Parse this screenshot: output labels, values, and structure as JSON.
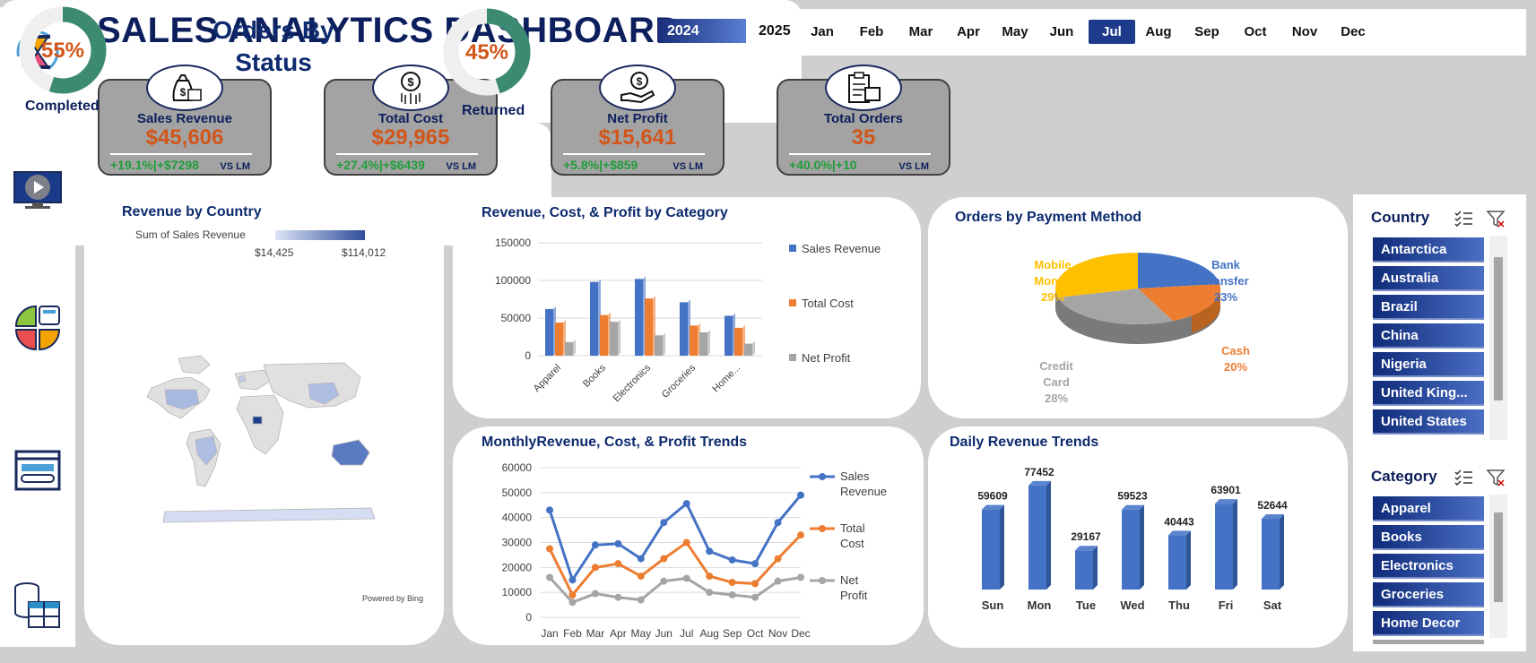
{
  "header": {
    "title": "SALES ANALYTICS DASHBOARD",
    "years": [
      "2024",
      "2025"
    ],
    "selected_year": "2024",
    "months": [
      "Jan",
      "Feb",
      "Mar",
      "Apr",
      "May",
      "Jun",
      "Jul",
      "Aug",
      "Sep",
      "Oct",
      "Nov",
      "Dec"
    ],
    "selected_month": "Jul"
  },
  "kpis": [
    {
      "title": "Sales Revenue",
      "value": "$45,606",
      "change": "+19.1%|+$7298",
      "vs": "VS LM",
      "icon": "money-bag-icon"
    },
    {
      "title": "Total Cost",
      "value": "$29,965",
      "change": "+27.4%|+$6439",
      "vs": "VS LM",
      "icon": "dollar-arrows-icon"
    },
    {
      "title": "Net Profit",
      "value": "$15,641",
      "change": "+5.8%|+$859",
      "vs": "VS LM",
      "icon": "hand-dollar-icon"
    },
    {
      "title": "Total Orders",
      "value": "35",
      "change": "+40.0%|+10",
      "vs": "VS LM",
      "icon": "clipboard-box-icon"
    }
  ],
  "orders_status": {
    "title_line1": "Orders By",
    "title_line2": "Status",
    "completed_label": "Completed",
    "completed_pct": "55%",
    "completed_value": 55,
    "returned_label": "Returned",
    "returned_pct": "45%",
    "returned_value": 45
  },
  "map": {
    "title": "Revenue by Country",
    "legend_title": "Sum of Sales Revenue",
    "legend_min": "$14,425",
    "legend_max": "$114,012",
    "attribution": "Powered by Bing"
  },
  "category_chart": {
    "title": "Revenue, Cost, & Profit by Category",
    "y_ticks": [
      "150000",
      "100000",
      "50000",
      "0"
    ],
    "categories": [
      "Apparel",
      "Books",
      "Electronics",
      "Groceries",
      "Home..."
    ],
    "legend": [
      "Sales Revenue",
      "Total Cost",
      "Net Profit"
    ]
  },
  "payment_chart": {
    "title": "Orders by Payment Method",
    "slices": [
      {
        "name": "Bank Transfer",
        "line1": "Bank",
        "line2": "Transfer",
        "pct": "23%",
        "value": 23,
        "color": "#4472c4"
      },
      {
        "name": "Cash",
        "line1": "Cash",
        "line2": "",
        "pct": "20%",
        "value": 20,
        "color": "#ed7d31"
      },
      {
        "name": "Credit Card",
        "line1": "Credit",
        "line2": "Card",
        "pct": "28%",
        "value": 28,
        "color": "#a5a5a5"
      },
      {
        "name": "Mobile Money",
        "line1": "Mobile",
        "line2": "Money",
        "pct": "29%",
        "value": 29,
        "color": "#ffc000"
      }
    ]
  },
  "monthly_chart": {
    "title": "MonthlyRevenue, Cost, & Profit Trends",
    "y_ticks": [
      "60000",
      "50000",
      "40000",
      "30000",
      "20000",
      "10000",
      "0"
    ],
    "months": [
      "Jan",
      "Feb",
      "Mar",
      "Apr",
      "May",
      "Jun",
      "Jul",
      "Aug",
      "Sep",
      "Oct",
      "Nov",
      "Dec"
    ],
    "legend": [
      {
        "line1": "Sales",
        "line2": "Revenue"
      },
      {
        "line1": "Total",
        "line2": "Cost"
      },
      {
        "line1": "Net",
        "line2": "Profit"
      }
    ]
  },
  "daily_chart": {
    "title": "Daily Revenue Trends"
  },
  "slicers": {
    "country_title": "Country",
    "countries": [
      "Antarctica",
      "Australia",
      "Brazil",
      "China",
      "Nigeria",
      "United King...",
      "United States"
    ],
    "category_title": "Category",
    "categories": [
      "Apparel",
      "Books",
      "Electronics",
      "Groceries",
      "Home Decor"
    ]
  },
  "chart_data": [
    {
      "type": "bar",
      "title": "Revenue, Cost, & Profit by Category",
      "categories": [
        "Apparel",
        "Books",
        "Electronics",
        "Groceries",
        "Home..."
      ],
      "ylim": [
        0,
        150000
      ],
      "series": [
        {
          "name": "Sales Revenue",
          "values": [
            62000,
            98000,
            102000,
            71000,
            53000
          ],
          "color": "#4472c4"
        },
        {
          "name": "Total Cost",
          "values": [
            44000,
            54000,
            76000,
            40000,
            37000
          ],
          "color": "#ed7d31"
        },
        {
          "name": "Net Profit",
          "values": [
            18000,
            45000,
            27000,
            31000,
            16000
          ],
          "color": "#a5a5a5"
        }
      ]
    },
    {
      "type": "pie",
      "title": "Orders by Payment Method",
      "categories": [
        "Bank Transfer",
        "Cash",
        "Credit Card",
        "Mobile Money"
      ],
      "values": [
        23,
        20,
        28,
        29
      ]
    },
    {
      "type": "line",
      "title": "MonthlyRevenue, Cost, & Profit Trends",
      "categories": [
        "Jan",
        "Feb",
        "Mar",
        "Apr",
        "May",
        "Jun",
        "Jul",
        "Aug",
        "Sep",
        "Oct",
        "Nov",
        "Dec"
      ],
      "ylim": [
        0,
        60000
      ],
      "series": [
        {
          "name": "Sales Revenue",
          "values": [
            43000,
            15000,
            29000,
            29500,
            23500,
            38000,
            45606,
            26500,
            23000,
            21500,
            38000,
            49000
          ],
          "color": "#4472c4"
        },
        {
          "name": "Total Cost",
          "values": [
            27500,
            9000,
            20000,
            21500,
            16500,
            23500,
            29965,
            16500,
            14000,
            13500,
            23500,
            33000
          ],
          "color": "#ed7d31"
        },
        {
          "name": "Net Profit",
          "values": [
            16000,
            6000,
            9500,
            8000,
            7000,
            14500,
            15641,
            10000,
            9000,
            8000,
            14500,
            16000
          ],
          "color": "#a5a5a5"
        }
      ]
    },
    {
      "type": "bar",
      "title": "Daily Revenue Trends",
      "categories": [
        "Sun",
        "Mon",
        "Tue",
        "Wed",
        "Thu",
        "Fri",
        "Sat"
      ],
      "values": [
        59609,
        77452,
        29167,
        59523,
        40443,
        63901,
        52644
      ],
      "color": "#4472c4"
    }
  ]
}
